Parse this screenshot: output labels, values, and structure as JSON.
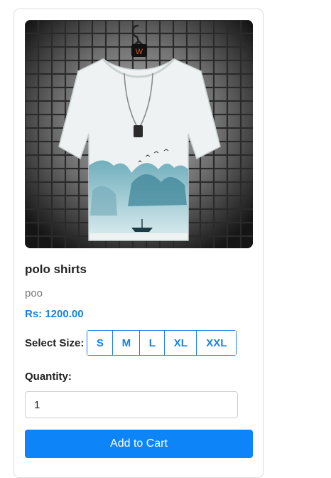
{
  "product": {
    "name": "polo shirts",
    "description": "poo",
    "price": "Rs: 1200.00",
    "image_icon": "tshirt-image"
  },
  "size_selector": {
    "label": "Select Size:",
    "options": [
      "S",
      "M",
      "L",
      "XL",
      "XXL"
    ]
  },
  "quantity": {
    "label": "Quantity:",
    "value": "1"
  },
  "cart": {
    "button_label": "Add to Cart"
  },
  "colors": {
    "accent": "#1a80e6",
    "button_bg": "#0d84f7"
  }
}
